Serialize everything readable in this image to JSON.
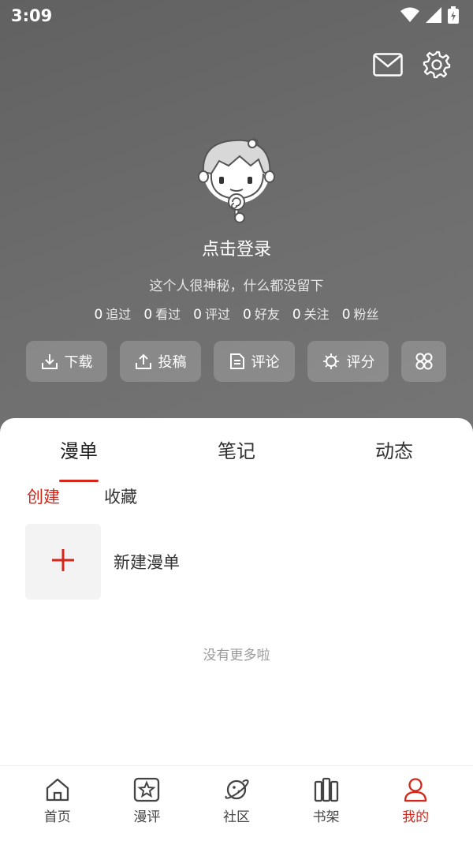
{
  "status": {
    "time": "3:09"
  },
  "profile": {
    "login_text": "点击登录",
    "bio": "这个人很神秘，什么都没留下",
    "stats": [
      {
        "num": "0",
        "label": "追过"
      },
      {
        "num": "0",
        "label": "看过"
      },
      {
        "num": "0",
        "label": "评过"
      },
      {
        "num": "0",
        "label": "好友"
      },
      {
        "num": "0",
        "label": "关注"
      },
      {
        "num": "0",
        "label": "粉丝"
      }
    ]
  },
  "quick_actions": [
    {
      "label": "下载",
      "icon": "download-icon"
    },
    {
      "label": "投稿",
      "icon": "upload-icon"
    },
    {
      "label": "评论",
      "icon": "document-icon"
    },
    {
      "label": "评分",
      "icon": "rating-icon"
    },
    {
      "label": "",
      "icon": "grid-icon"
    }
  ],
  "tabs": [
    "漫单",
    "笔记",
    "动态"
  ],
  "active_tab": "漫单",
  "subtabs": [
    "创建",
    "收藏"
  ],
  "active_subtab": "创建",
  "create_label": "新建漫单",
  "no_more_text": "没有更多啦",
  "bottom_nav": [
    {
      "label": "首页",
      "icon": "home-icon"
    },
    {
      "label": "漫评",
      "icon": "star-icon"
    },
    {
      "label": "社区",
      "icon": "planet-icon"
    },
    {
      "label": "书架",
      "icon": "bookshelf-icon"
    },
    {
      "label": "我的",
      "icon": "user-icon"
    }
  ],
  "active_nav": "我的",
  "colors": {
    "accent": "#d6261a",
    "header_bg": "#6a6a6a"
  }
}
